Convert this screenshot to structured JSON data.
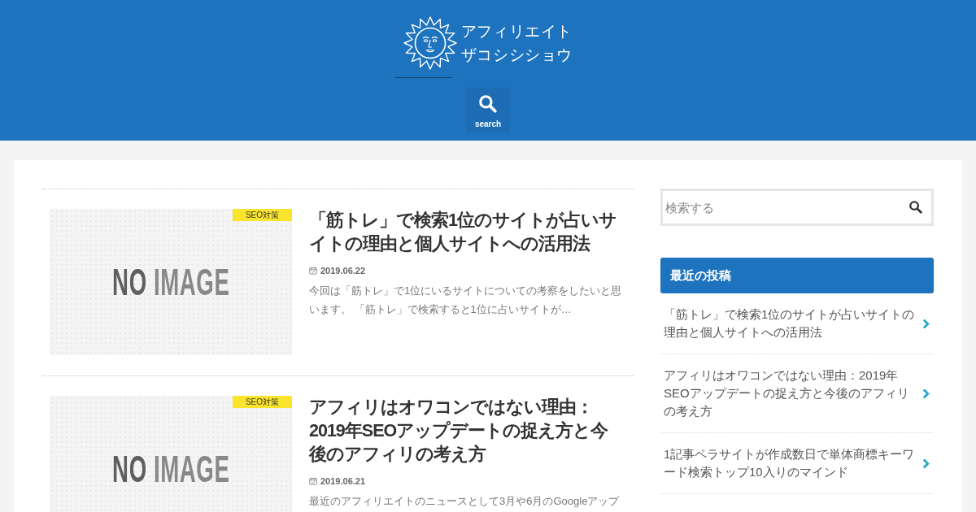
{
  "header": {
    "site_title": [
      "アフィリエイト",
      "ザコシシショウ"
    ],
    "search_button": {
      "label": "search"
    }
  },
  "posts": [
    {
      "category": "SEO対策",
      "thumbnail_label": "NO IMAGE",
      "title": "「筋トレ」で検索1位のサイトが占いサイトの理由と個人サイトへの活用法",
      "date": "2019.06.22",
      "excerpt": "今回は「筋トレ」で1位にいるサイトについての考察をしたいと思います。 「筋トレ」で検索すると1位に占いサイトが…"
    },
    {
      "category": "SEO対策",
      "thumbnail_label": "NO IMAGE",
      "title": "アフィリはオワコンではない理由：2019年SEOアップデートの捉え方と今後のアフィリの考え方",
      "date": "2019.06.21",
      "excerpt": "最近のアフィリエイトのニュースとして3月や6月のGoogleアップ"
    }
  ],
  "sidebar": {
    "search": {
      "placeholder": "検索する"
    },
    "recent_posts": {
      "title": "最近の投稿",
      "items": [
        "「筋トレ」で検索1位のサイトが占いサイトの理由と個人サイトへの活用法",
        "アフィリはオワコンではない理由：2019年SEOアップデートの捉え方と今後のアフィリの考え方",
        "1記事ペラサイトが作成数日で単体商標キーワード検索トップ10入りのマインド"
      ]
    }
  }
}
